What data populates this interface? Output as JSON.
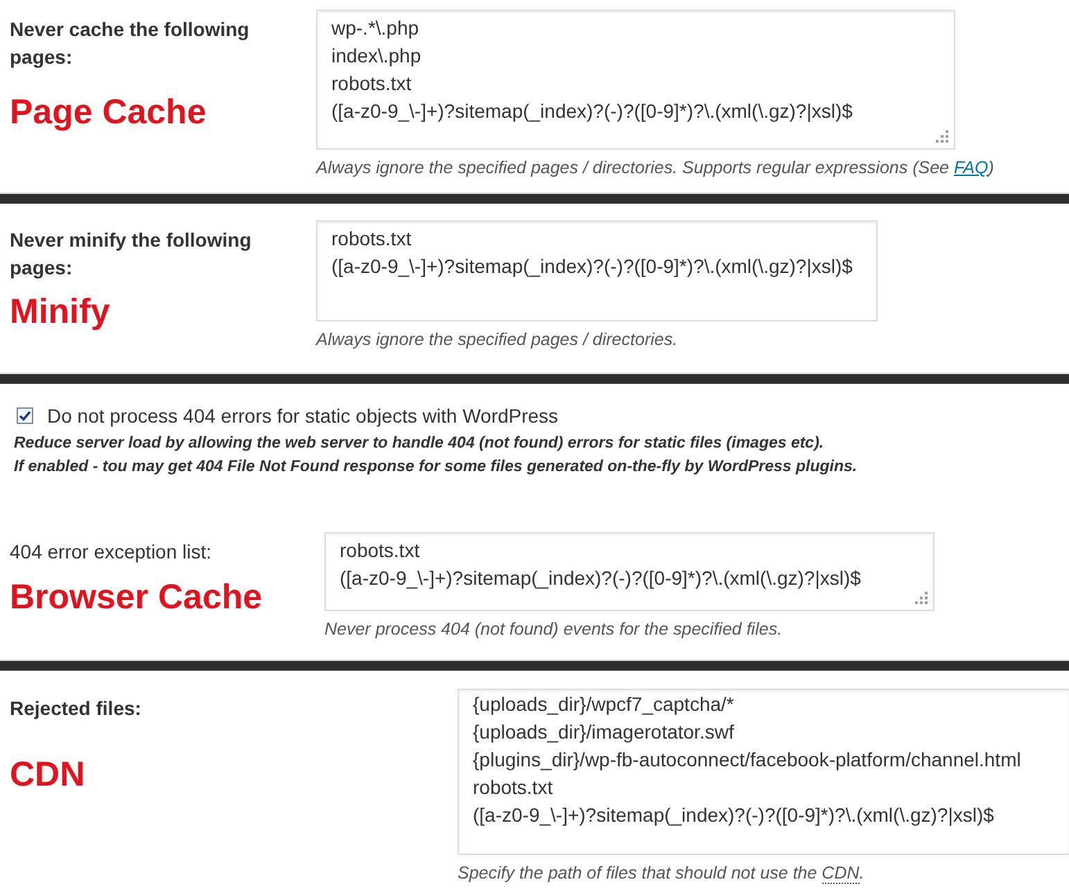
{
  "sections": [
    {
      "rows": [
        {
          "kind": "textarea",
          "label": "Never cache the following pages:",
          "tag": "Page Cache",
          "lines": [
            "wp-.*\\.php",
            "index\\.php",
            "robots.txt",
            "([a-z0-9_\\-]+)?sitemap(_index)?(-)?([0-9]*)?\\.(xml(\\.gz)?|xsl)$"
          ],
          "resize_grip": true,
          "description": [
            {
              "kind": "text",
              "text": "Always ignore the specified pages / directories. Supports regular expressions (See "
            },
            {
              "kind": "link",
              "text": "FAQ"
            },
            {
              "kind": "text",
              "text": ")"
            }
          ]
        }
      ]
    },
    {
      "rows": [
        {
          "kind": "textarea",
          "label": "Never minify the following pages:",
          "tag": "Minify",
          "lines": [
            "robots.txt",
            "([a-z0-9_\\-]+)?sitemap(_index)?(-)?([0-9]*)?\\.(xml(\\.gz)?|xsl)$"
          ],
          "resize_grip": false,
          "description": [
            {
              "kind": "text",
              "text": "Always ignore the specified pages / directories."
            }
          ]
        }
      ]
    },
    {
      "rows": [
        {
          "kind": "checkbox",
          "label": "Do not process 404 errors for static objects with WordPress",
          "checked": true,
          "notes": [
            "Reduce server load by allowing the web server to handle 404 (not found) errors for static files (images etc).",
            "If enabled - tou may get 404 File Not Found response for some files generated on-the-fly by WordPress plugins."
          ]
        },
        {
          "kind": "textarea",
          "label": "404 error exception list:",
          "tag": "Browser Cache",
          "lines": [
            "robots.txt",
            "([a-z0-9_\\-]+)?sitemap(_index)?(-)?([0-9]*)?\\.(xml(\\.gz)?|xsl)$"
          ],
          "resize_grip": true,
          "description": [
            {
              "kind": "text",
              "text": "Never process 404 (not found) events for the specified files."
            }
          ]
        }
      ]
    },
    {
      "rows": [
        {
          "kind": "textarea",
          "label": "Rejected files:",
          "tag": "CDN",
          "lines": [
            "{uploads_dir}/wpcf7_captcha/*",
            "{uploads_dir}/imagerotator.swf",
            "{plugins_dir}/wp-fb-autoconnect/facebook-platform/channel.html",
            "robots.txt",
            "([a-z0-9_\\-]+)?sitemap(_index)?(-)?([0-9]*)?\\.(xml(\\.gz)?|xsl)$"
          ],
          "resize_grip": false,
          "description": [
            {
              "kind": "text",
              "text": "Specify the path of files that should not use the "
            },
            {
              "kind": "abbr",
              "text": "CDN"
            },
            {
              "kind": "text",
              "text": "."
            }
          ]
        }
      ]
    }
  ]
}
